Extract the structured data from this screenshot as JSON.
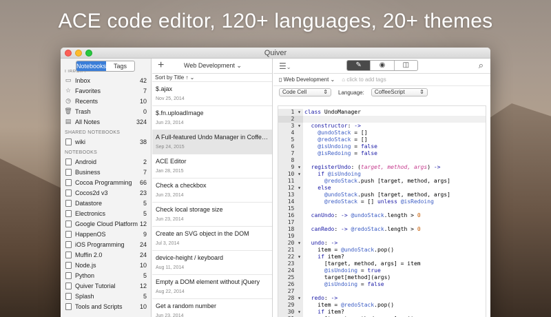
{
  "headline": "ACE code editor, 120+ languages, 20+ themes",
  "window_title": "Quiver",
  "sidebar": {
    "tabs": [
      {
        "label": "Notebooks",
        "active": true
      },
      {
        "label": "Tags",
        "active": false
      }
    ],
    "top_label": "LIBRARY",
    "library": [
      {
        "icon": "inbox-icon",
        "glyph": "▭",
        "label": "Inbox",
        "count": "42"
      },
      {
        "icon": "star-icon",
        "glyph": "☆",
        "label": "Favorites",
        "count": "7"
      },
      {
        "icon": "clock-icon",
        "glyph": "◷",
        "label": "Recents",
        "count": "10"
      },
      {
        "icon": "trash-icon",
        "glyph": "🗑",
        "label": "Trash",
        "count": "0"
      },
      {
        "icon": "all-notes-icon",
        "glyph": "▤",
        "label": "All Notes",
        "count": "324"
      }
    ],
    "shared_label": "SHARED NOTEBOOKS",
    "shared": [
      {
        "label": "wiki",
        "count": "38"
      }
    ],
    "notebooks_label": "NOTEBOOKS",
    "notebooks": [
      {
        "label": "Android",
        "count": "2"
      },
      {
        "label": "Business",
        "count": "7"
      },
      {
        "label": "Cocoa Programming",
        "count": "66"
      },
      {
        "label": "Cocos2d v3",
        "count": "23"
      },
      {
        "label": "Datastore",
        "count": "5"
      },
      {
        "label": "Electronics",
        "count": "5"
      },
      {
        "label": "Google Cloud Platform",
        "count": "12"
      },
      {
        "label": "HappenOS",
        "count": "9"
      },
      {
        "label": "iOS Programming",
        "count": "24"
      },
      {
        "label": "Muffin 2.0",
        "count": "24"
      },
      {
        "label": "Node.js",
        "count": "10"
      },
      {
        "label": "Python",
        "count": "5"
      },
      {
        "label": "Quiver Tutorial",
        "count": "12"
      },
      {
        "label": "Splash",
        "count": "5"
      },
      {
        "label": "Tools and Scripts",
        "count": "10"
      }
    ]
  },
  "notelist": {
    "notebook": "Web Development",
    "sort_label": "Sort by Title ↑ ⌄",
    "notes": [
      {
        "title": "$.ajax",
        "date": "Nov 25, 2014",
        "selected": false
      },
      {
        "title": "$.fn.uploadImage",
        "date": "Jun 23, 2014",
        "selected": false
      },
      {
        "title": "A Full-featured Undo Manager in CoffeeScript",
        "date": "Sep 24, 2015",
        "selected": true
      },
      {
        "title": "ACE Editor",
        "date": "Jan 28, 2015",
        "selected": false
      },
      {
        "title": "Check a checkbox",
        "date": "Jun 23, 2014",
        "selected": false
      },
      {
        "title": "Check local storage size",
        "date": "Jun 23, 2014",
        "selected": false
      },
      {
        "title": "Create an SVG object in the DOM",
        "date": "Jul 3, 2014",
        "selected": false
      },
      {
        "title": "device-height / keyboard",
        "date": "Aug 11, 2014",
        "selected": false
      },
      {
        "title": "Empty a DOM element without jQuery",
        "date": "Aug 22, 2014",
        "selected": false
      },
      {
        "title": "Get a random number",
        "date": "Jun 23, 2014",
        "selected": false
      }
    ]
  },
  "editor": {
    "notebook": "Web Development",
    "tag_placeholder": "click to add tags",
    "cell_type": "Code Cell",
    "language_label": "Language:",
    "language": "CoffeeScript",
    "lines": [
      {
        "n": "1",
        "fold": "▾",
        "html": "<span class='kw'>class</span> UndoManager"
      },
      {
        "n": "2",
        "fold": "",
        "html": "",
        "current": true
      },
      {
        "n": "3",
        "fold": "▾",
        "html": "  <span class='kw'>constructor</span>: <span class='kw'>-&gt;</span>"
      },
      {
        "n": "4",
        "fold": "",
        "html": "    <span class='iv'>@undoStack</span> = []"
      },
      {
        "n": "5",
        "fold": "",
        "html": "    <span class='iv'>@redoStack</span> = []"
      },
      {
        "n": "6",
        "fold": "",
        "html": "    <span class='iv'>@isUndoing</span> = <span class='kw'>false</span>"
      },
      {
        "n": "7",
        "fold": "",
        "html": "    <span class='iv'>@isRedoing</span> = <span class='kw'>false</span>"
      },
      {
        "n": "8",
        "fold": "",
        "html": ""
      },
      {
        "n": "9",
        "fold": "▾",
        "html": "  <span class='kw'>registerUndo</span>: (<span class='pm'>target, method, args</span>) <span class='kw'>-&gt;</span>"
      },
      {
        "n": "10",
        "fold": "▾",
        "html": "    <span class='kw'>if</span> <span class='iv'>@isUndoing</span>"
      },
      {
        "n": "11",
        "fold": "",
        "html": "      <span class='iv'>@redoStack</span>.push [target, method, args]"
      },
      {
        "n": "12",
        "fold": "▾",
        "html": "    <span class='kw'>else</span>"
      },
      {
        "n": "13",
        "fold": "",
        "html": "      <span class='iv'>@undoStack</span>.push [target, method, args]"
      },
      {
        "n": "14",
        "fold": "",
        "html": "      <span class='iv'>@redoStack</span> = [] <span class='kw'>unless</span> <span class='iv'>@isRedoing</span>"
      },
      {
        "n": "15",
        "fold": "",
        "html": ""
      },
      {
        "n": "16",
        "fold": "",
        "html": "  <span class='kw'>canUndo</span>: <span class='kw'>-&gt;</span> <span class='iv'>@undoStack</span>.length &gt; <span class='co'>0</span>"
      },
      {
        "n": "17",
        "fold": "",
        "html": ""
      },
      {
        "n": "18",
        "fold": "",
        "html": "  <span class='kw'>canRedo</span>: <span class='kw'>-&gt;</span> <span class='iv'>@redoStack</span>.length &gt; <span class='co'>0</span>"
      },
      {
        "n": "19",
        "fold": "",
        "html": ""
      },
      {
        "n": "20",
        "fold": "▾",
        "html": "  <span class='kw'>undo</span>: <span class='kw'>-&gt;</span>"
      },
      {
        "n": "21",
        "fold": "",
        "html": "    item = <span class='iv'>@undoStack</span>.pop()"
      },
      {
        "n": "22",
        "fold": "▾",
        "html": "    <span class='kw'>if</span> item?"
      },
      {
        "n": "23",
        "fold": "",
        "html": "      [target, method, args] = item"
      },
      {
        "n": "24",
        "fold": "",
        "html": "      <span class='iv'>@isUndoing</span> = <span class='kw'>true</span>"
      },
      {
        "n": "25",
        "fold": "",
        "html": "      target[method](args)"
      },
      {
        "n": "26",
        "fold": "",
        "html": "      <span class='iv'>@isUndoing</span> = <span class='kw'>false</span>"
      },
      {
        "n": "27",
        "fold": "",
        "html": ""
      },
      {
        "n": "28",
        "fold": "▾",
        "html": "  <span class='kw'>redo</span>: <span class='kw'>-&gt;</span>"
      },
      {
        "n": "29",
        "fold": "",
        "html": "    item = <span class='iv'>@redoStack</span>.pop()"
      },
      {
        "n": "30",
        "fold": "▾",
        "html": "    <span class='kw'>if</span> item?"
      },
      {
        "n": "31",
        "fold": "",
        "html": "      [target, method, args] = item"
      }
    ]
  }
}
